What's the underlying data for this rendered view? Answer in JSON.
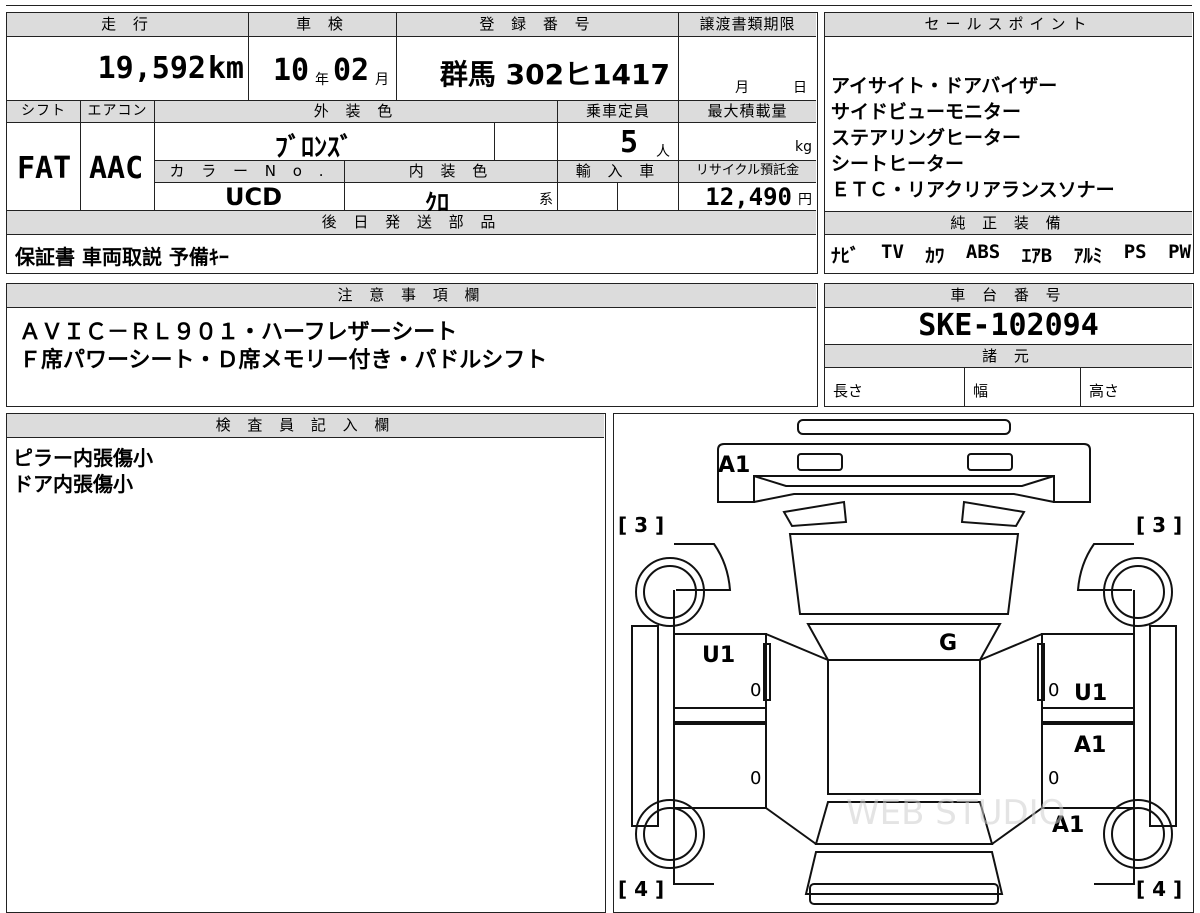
{
  "headers": {
    "mileage": "走 行",
    "inspection": "車 検",
    "registration": "登 録 番 号",
    "transfer_deadline": "譲渡書類期限",
    "sales_point": "セールスポイント",
    "shift": "シフト",
    "aircon": "エアコン",
    "exterior_color": "外 装 色",
    "capacity": "乗車定員",
    "max_load": "最大積載量",
    "color_no": "カ ラ ー N o .",
    "interior_color": "内 装 色",
    "import": "輸 入 車",
    "recycle_fee": "リサイクル預託金",
    "later_parts": "後 日 発 送 部 品",
    "genuine_equipment": "純 正 装 備",
    "notes": "注 意 事 項 欄",
    "chassis_no": "車 台 番 号",
    "specs": "諸 元",
    "inspector": "検 査 員 記 入 欄"
  },
  "mileage": {
    "value": "19,592",
    "unit": "km"
  },
  "inspection": {
    "year": "10",
    "year_unit": "年",
    "month": "02",
    "month_unit": "月"
  },
  "registration": {
    "value": "群馬 302ヒ1417"
  },
  "transfer_deadline": {
    "month_unit": "月",
    "day_unit": "日"
  },
  "shift": "FAT",
  "aircon": "AAC",
  "exterior_color": "ﾌﾞﾛﾝｽﾞ",
  "capacity": {
    "value": "5",
    "unit": "人"
  },
  "max_load": {
    "unit": "kg"
  },
  "color_no": "UCD",
  "interior_color": {
    "value": "ｸﾛ",
    "unit": "系"
  },
  "recycle_fee": {
    "value": "12,490",
    "unit": "円"
  },
  "later_parts": "保証書 車両取説 予備ｷｰ",
  "sales_points": [
    "アイサイト・ドアバイザー",
    "サイドビューモニター",
    "ステアリングヒーター",
    "シートヒーター",
    "ＥＴＣ・リアクリアランスソナー"
  ],
  "genuine_equipment": [
    "ﾅﾋﾞ",
    "TV",
    "ｶﾜ",
    "ABS",
    "ｴｱB",
    "ｱﾙﾐ",
    "PS",
    "PW"
  ],
  "notes": [
    "ＡＶＩＣ－ＲＬ９０１・ハーフレザーシート",
    "Ｆ席パワーシート・Ｄ席メモリー付き・パドルシフト"
  ],
  "chassis_no": "SKE-102094",
  "specs": {
    "length": "長さ",
    "width": "幅",
    "height": "高さ"
  },
  "inspector_notes": [
    "ピラー内張傷小",
    "ドア内張傷小"
  ],
  "diagram": {
    "marks": {
      "front": "A1",
      "windshield": "G",
      "left_front_door": "U1",
      "right_front_door": "U1",
      "right_rear_door": "A1",
      "right_rear_fender": "A1"
    },
    "tire_left_front": "[ 3 ]",
    "tire_right_front": "[ 3 ]",
    "tire_left_rear": "[ 4 ]",
    "tire_right_rear": "[ 4 ]",
    "door_zero": "0",
    "watermark": "WEB STUDIO"
  }
}
